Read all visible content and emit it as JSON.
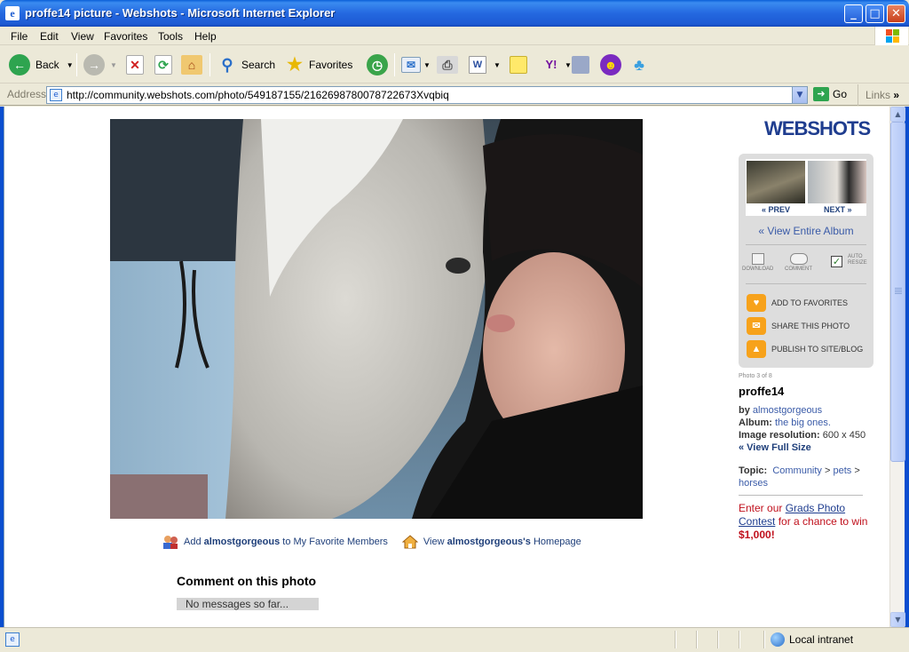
{
  "window": {
    "title": "proffe14 picture - Webshots - Microsoft Internet Explorer",
    "app_icon": "ie-icon"
  },
  "menu": [
    "File",
    "Edit",
    "View",
    "Favorites",
    "Tools",
    "Help"
  ],
  "toolbar": {
    "back_label": "Back",
    "search_label": "Search",
    "favorites_label": "Favorites"
  },
  "address": {
    "label": "Address",
    "url": "http://community.webshots.com/photo/549187155/2162698780078722673Xvqbiq",
    "go_label": "Go",
    "links_label": "Links"
  },
  "page": {
    "logo": "WEBSHOTS",
    "add_prefix": "Add",
    "member_name": "almostgorgeous",
    "add_suffix": "to My Favorite Members",
    "view_prefix": "View",
    "member_possessive": "almostgorgeous's",
    "view_suffix": "Homepage",
    "comment_title": "Comment on this photo",
    "no_messages": "No messages so far..."
  },
  "sidebar": {
    "prev_label": "« PREV",
    "next_label": "NEXT »",
    "view_album": "« View Entire Album",
    "download_label": "DOWNLOAD",
    "comment_label": "COMMENT",
    "auto_resize_line1": "AUTO",
    "auto_resize_line2": "RESIZE",
    "auto_resize_checked": true,
    "add_favorites": "ADD TO FAVORITES",
    "share_photo": "SHARE THIS PHOTO",
    "publish": "PUBLISH TO SITE/BLOG",
    "photo_count": "Photo 3 of 8",
    "owner": "proffe14",
    "by_label": "by",
    "by_value": "almostgorgeous",
    "album_label": "Album:",
    "album_value": "the big ones.",
    "resolution_label": "Image resolution:",
    "resolution_value": "600 x 450",
    "full_size": "« View Full Size",
    "topic_label": "Topic:",
    "topic_1": "Community",
    "topic_sep": ">",
    "topic_2": "pets",
    "topic_3": "horses",
    "promo_prefix": "Enter our",
    "promo_link": "Grads Photo Contest",
    "promo_suffix": "for a chance to win",
    "promo_amount": "$1,000!"
  },
  "status": {
    "zone": "Local intranet"
  },
  "colors": {
    "accent": "#1f3d8f",
    "orange": "#f7a21b",
    "promo_red": "#c0101c",
    "titlebar": "#2468e0"
  }
}
